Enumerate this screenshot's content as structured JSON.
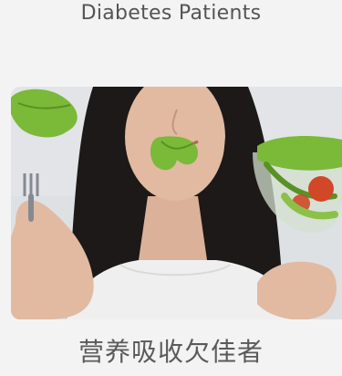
{
  "card": {
    "title": "Diabetes Patients",
    "caption": "营养吸收欠佳者"
  },
  "photo": {
    "icon": "woman-eating-salad-image",
    "colors": {
      "background": "#e6e9ec",
      "hair": "#1d1a19",
      "skin": "#e9c0a7",
      "shirt": "#f7f7f7",
      "lettuce": "#7fbf3a",
      "tomato": "#d84a2a",
      "fork": "#8a8f96"
    }
  }
}
